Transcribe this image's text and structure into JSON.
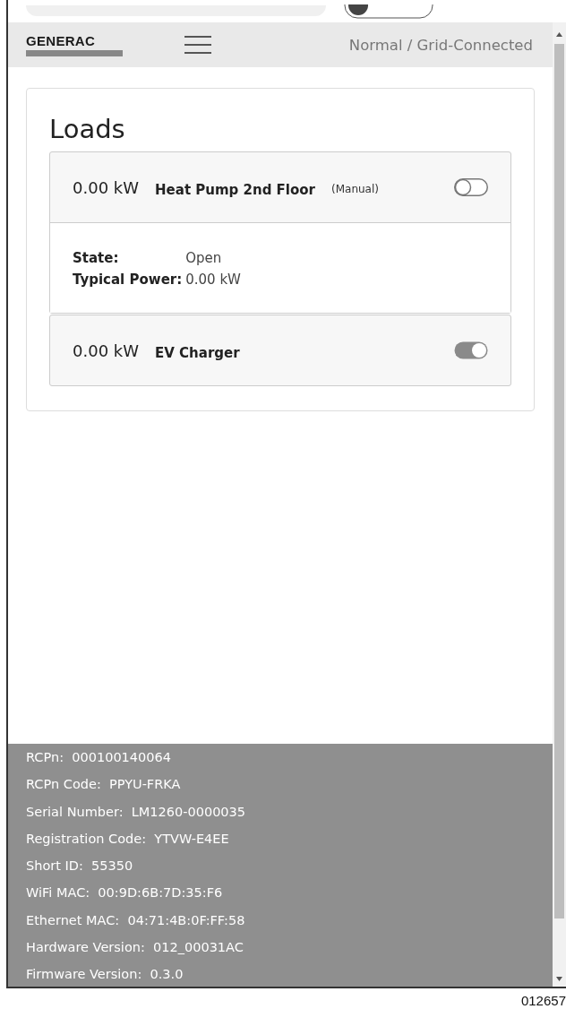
{
  "header": {
    "logo": "GENERAC",
    "status": "Normal / Grid-Connected"
  },
  "loads": {
    "title": "Loads",
    "items": [
      {
        "power": "0.00 kW",
        "name": "Heat Pump 2nd Floor",
        "mode": "(Manual)",
        "on": false,
        "expanded": true,
        "details": [
          {
            "label": "State:",
            "value": "Open"
          },
          {
            "label": "Typical Power:",
            "value": "0.00 kW"
          }
        ]
      },
      {
        "power": "0.00 kW",
        "name": "EV Charger",
        "on": true,
        "expanded": false
      }
    ]
  },
  "device_info": [
    {
      "label": "RCPn:",
      "value": "000100140064"
    },
    {
      "label": "RCPn Code:",
      "value": "PPYU-FRKA"
    },
    {
      "label": "Serial Number:",
      "value": "LM1260-0000035"
    },
    {
      "label": "Registration Code:",
      "value": "YTVW-E4EE"
    },
    {
      "label": "Short ID:",
      "value": "55350"
    },
    {
      "label": "WiFi MAC:",
      "value": "00:9D:6B:7D:35:F6"
    },
    {
      "label": "Ethernet MAC:",
      "value": "04:71:4B:0F:FF:58"
    },
    {
      "label": "Hardware Version:",
      "value": "012_00031AC"
    },
    {
      "label": "Firmware Version:",
      "value": "0.3.0"
    }
  ],
  "figure_number": "012657"
}
